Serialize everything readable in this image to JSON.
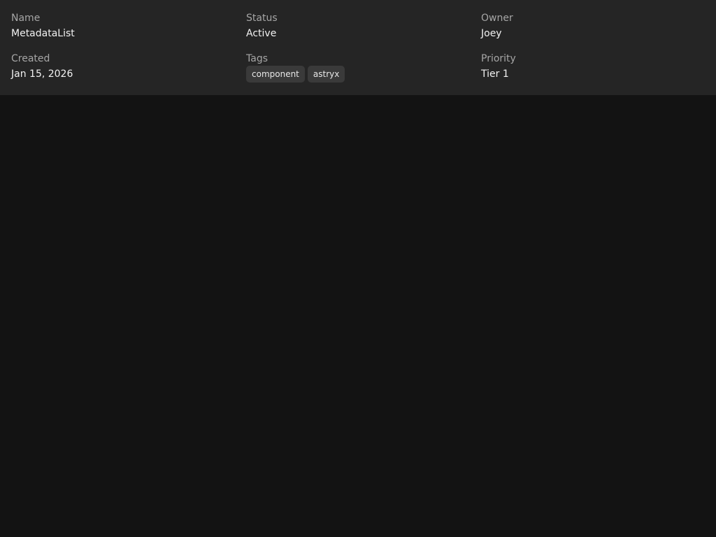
{
  "metadata": {
    "name": {
      "label": "Name",
      "value": "MetadataList"
    },
    "status": {
      "label": "Status",
      "value": "Active"
    },
    "owner": {
      "label": "Owner",
      "value": "Joey"
    },
    "created": {
      "label": "Created",
      "value": "Jan 15, 2026"
    },
    "tags": {
      "label": "Tags",
      "items": [
        "component",
        "astryx"
      ]
    },
    "priority": {
      "label": "Priority",
      "value": "Tier 1"
    }
  },
  "colors": {
    "background": "#131313",
    "panel": "#252525",
    "label": "#a6a6a6",
    "value": "#f2f2f2",
    "tag_bg": "#3a3a3a"
  }
}
